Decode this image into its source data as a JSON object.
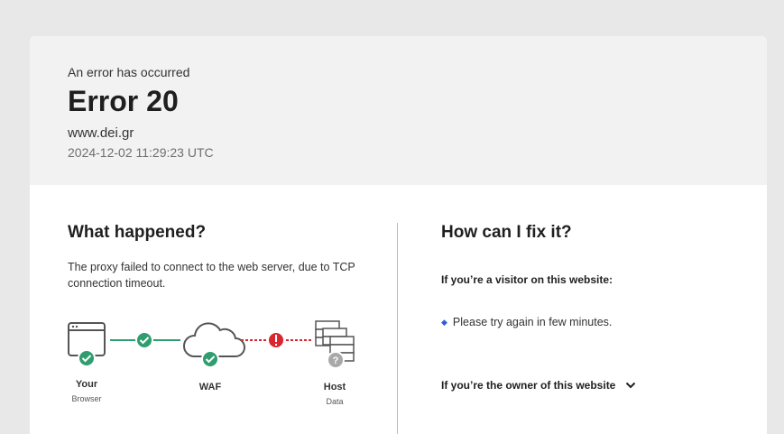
{
  "header": {
    "eyebrow": "An error has occurred",
    "title": "Error 20",
    "domain": "www.dei.gr",
    "timestamp": "2024-12-02 11:29:23 UTC"
  },
  "what_happened": {
    "heading": "What happened?",
    "description": "The proxy failed to connect to the web server, due to TCP connection timeout.",
    "diagram": {
      "browser": {
        "label": "Your",
        "sub": "Browser",
        "status": "ok"
      },
      "waf": {
        "label": "WAF",
        "sub": "",
        "status": "ok"
      },
      "host": {
        "label": "Host",
        "sub": "Data",
        "status": "unknown"
      },
      "link1_status": "ok",
      "link2_status": "error"
    }
  },
  "fix": {
    "heading": "How can I fix it?",
    "visitor_title": "If you’re a visitor on this website:",
    "visitor_tip": "Please try again in few minutes.",
    "owner_title": "If you’re the owner of this website"
  },
  "colors": {
    "ok": "#2e9e6e",
    "error": "#d9262f",
    "unknown": "#a9a9a9",
    "accent": "#2b5fd9"
  }
}
